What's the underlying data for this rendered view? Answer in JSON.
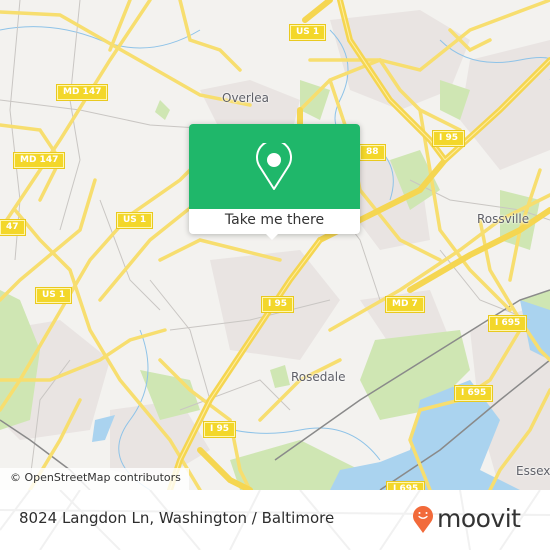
{
  "map": {
    "route_badges": [
      {
        "label": "US 1",
        "id": "us1-top"
      },
      {
        "label": "MD 147",
        "id": "md147-upper"
      },
      {
        "label": "MD 147",
        "id": "md147-lower"
      },
      {
        "label": "47",
        "id": "md147-edge"
      },
      {
        "label": "US 1",
        "id": "us1-mid"
      },
      {
        "label": "US 1",
        "id": "us1-left"
      },
      {
        "label": "I 95",
        "id": "i95-ne"
      },
      {
        "label": "88",
        "id": "route88"
      },
      {
        "label": "I 95",
        "id": "i95-center"
      },
      {
        "label": "MD 7",
        "id": "md7"
      },
      {
        "label": "I 695",
        "id": "i695-east"
      },
      {
        "label": "I 695",
        "id": "i695-mid"
      },
      {
        "label": "I 95",
        "id": "i95-south"
      },
      {
        "label": "I 695",
        "id": "i695-bottom"
      }
    ],
    "places": [
      {
        "name": "Overlea"
      },
      {
        "name": "Rossville"
      },
      {
        "name": "Rosedale"
      },
      {
        "name": "Essex"
      }
    ],
    "attribution": "© OpenStreetMap contributors"
  },
  "popup": {
    "icon": "map-pin-icon",
    "action_label": "Take me there",
    "color": "#1fb76a"
  },
  "footer": {
    "address": "8024 Langdon Ln, Washington / Baltimore",
    "brand": "moovit",
    "brand_color": "#f26a3a"
  }
}
